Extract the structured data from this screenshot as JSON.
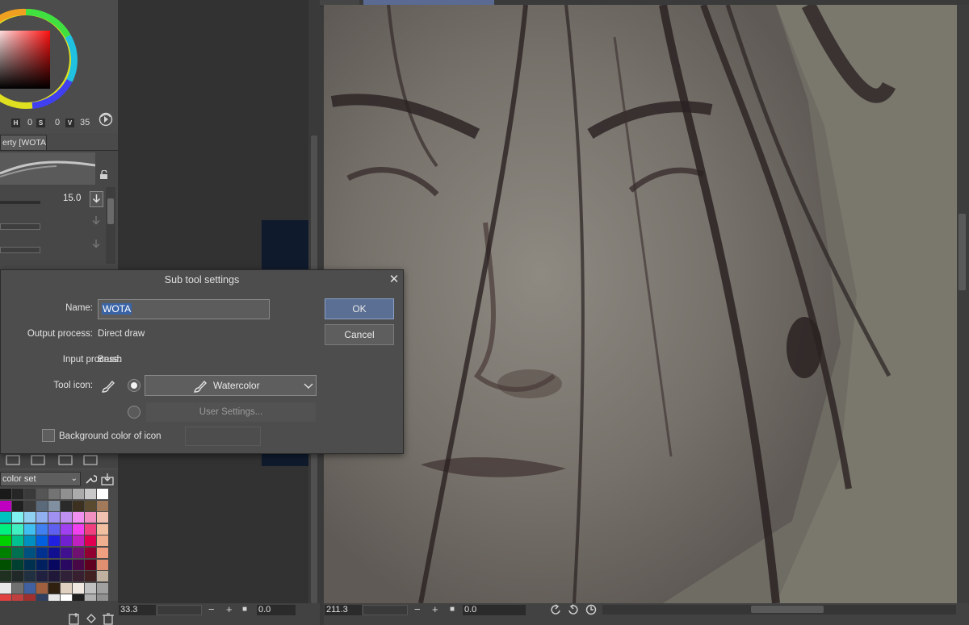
{
  "color_panel": {
    "h_tag": "H",
    "h_value": "0",
    "s_tag": "S",
    "s_value": "0",
    "v_tag": "V",
    "v_value": "35"
  },
  "tool_property": {
    "tab_label": "erty [WOTA]",
    "brush_size": "15.0"
  },
  "color_set": {
    "dropdown_label": "color set",
    "swatches": [
      "#1a1a1a",
      "#262626",
      "#3a3a3a",
      "#555555",
      "#737373",
      "#909090",
      "#ababab",
      "#c8c8c8",
      "#ffffff",
      "#c000c0",
      "#202020",
      "#3c3c3c",
      "#5a6a7a",
      "#8090a0",
      "#2a2a2a",
      "#3c3020",
      "#5a4a30",
      "#a07a5a",
      "#00c0c0",
      "#80f0f0",
      "#90d0f0",
      "#90b0f0",
      "#a090f0",
      "#c090f0",
      "#f090f0",
      "#f090c0",
      "#f0c0b0",
      "#00f080",
      "#40f0c0",
      "#40c0f0",
      "#4080f0",
      "#6060f0",
      "#a040f0",
      "#f040f0",
      "#f04080",
      "#f0c0a0",
      "#00d000",
      "#00c090",
      "#0090c0",
      "#0060e0",
      "#2020e0",
      "#7020d0",
      "#c020c0",
      "#e00050",
      "#f0b090",
      "#008000",
      "#007050",
      "#005080",
      "#003090",
      "#101090",
      "#401090",
      "#701070",
      "#900030",
      "#f0a080",
      "#005000",
      "#004030",
      "#003050",
      "#002060",
      "#080860",
      "#280860",
      "#480848",
      "#600020",
      "#e09070",
      "#203020",
      "#202828",
      "#203040",
      "#202040",
      "#201838",
      "#302038",
      "#382030",
      "#402020",
      "#c0b0a0",
      "#e8e8e8",
      "#707070",
      "#4060a0",
      "#a06040",
      "#302010",
      "#e0d0c0",
      "#f0e8e0",
      "#c0c0c0",
      "#a0a0a0",
      "#e04040",
      "#c04040",
      "#a03030",
      "#304060",
      "#e8e8e8",
      "#ffffff",
      "#202020",
      "#b0b0b0",
      "#909090"
    ]
  },
  "status_left": {
    "zoom": "33.3",
    "angle": "0.0"
  },
  "status_right": {
    "zoom": "211.3",
    "angle": "0.0"
  },
  "dialog": {
    "title": "Sub tool settings",
    "close_glyph": "✕",
    "name_label": "Name:",
    "name_value": "WOTA",
    "output_label": "Output process:",
    "output_value": "Direct draw",
    "input_label": "Input process:",
    "input_value": "Brush",
    "tool_icon_label": "Tool icon:",
    "icon_select_value": "Watercolor",
    "user_settings_label": "User Settings...",
    "bg_color_label": "Background color of icon",
    "ok_label": "OK",
    "cancel_label": "Cancel"
  },
  "status_glyphs": {
    "minus": "−",
    "plus": "+",
    "stop": "■"
  }
}
